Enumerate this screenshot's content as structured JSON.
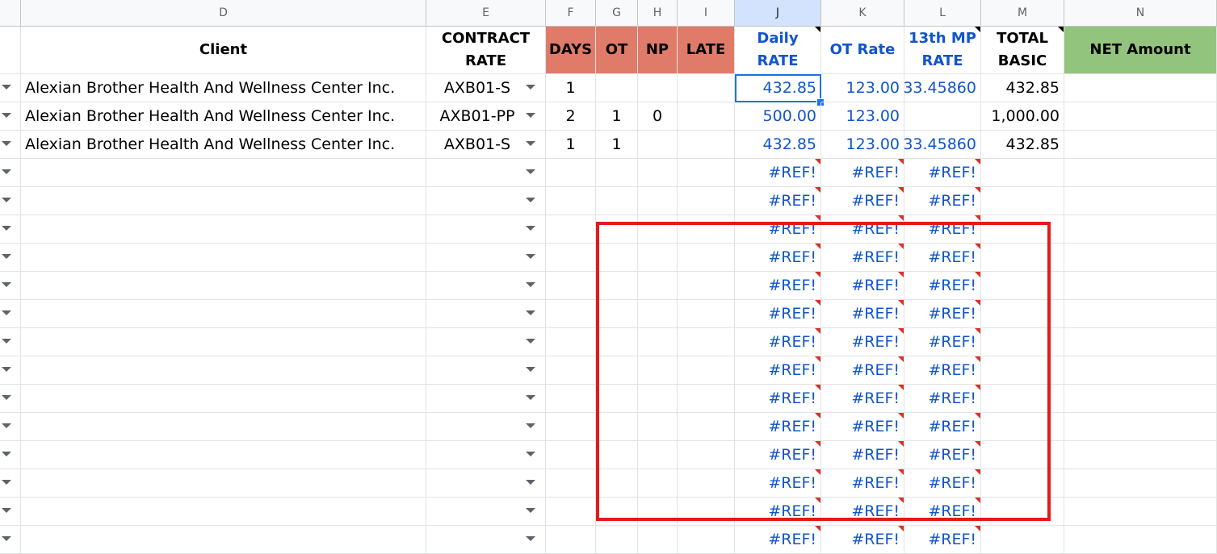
{
  "columns": [
    {
      "letter": "D",
      "selected": false
    },
    {
      "letter": "E",
      "selected": false
    },
    {
      "letter": "F",
      "selected": false
    },
    {
      "letter": "G",
      "selected": false
    },
    {
      "letter": "H",
      "selected": false
    },
    {
      "letter": "I",
      "selected": false
    },
    {
      "letter": "J",
      "selected": true
    },
    {
      "letter": "K",
      "selected": false
    },
    {
      "letter": "L",
      "selected": false
    },
    {
      "letter": "M",
      "selected": false
    },
    {
      "letter": "N",
      "selected": false
    }
  ],
  "headers": [
    {
      "text": "Client",
      "style": "plain",
      "note": false
    },
    {
      "text": "CONTRACT RATE",
      "style": "plain",
      "note": false
    },
    {
      "text": "DAYS",
      "style": "salmon",
      "note": false
    },
    {
      "text": "OT",
      "style": "salmon",
      "note": false
    },
    {
      "text": "NP",
      "style": "salmon",
      "note": false
    },
    {
      "text": "LATE",
      "style": "salmon",
      "note": false
    },
    {
      "text": "Daily RATE",
      "style": "blue",
      "note": true
    },
    {
      "text": "OT Rate",
      "style": "blue",
      "note": false
    },
    {
      "text": "13th MP RATE",
      "style": "blue",
      "note": true
    },
    {
      "text": "TOTAL BASIC",
      "style": "plain",
      "note": true
    },
    {
      "text": "NET Amount",
      "style": "green",
      "note": false
    }
  ],
  "rows": [
    [
      "Alexian Brother Health And Wellness Center Inc.",
      "AXB01-S",
      "1",
      "",
      "",
      "",
      "432.85",
      "123.00",
      "33.45860",
      "432.85",
      ""
    ],
    [
      "Alexian Brother Health And Wellness Center Inc.",
      "AXB01-PP",
      "2",
      "1",
      "0",
      "",
      "500.00",
      "123.00",
      "",
      "1,000.00",
      ""
    ],
    [
      "Alexian Brother Health And Wellness Center Inc.",
      "AXB01-S",
      "1",
      "1",
      "",
      "",
      "432.85",
      "123.00",
      "33.45860",
      "432.85",
      ""
    ],
    [
      "",
      "",
      "",
      "",
      "",
      "",
      "#REF!",
      "#REF!",
      "#REF!",
      "",
      ""
    ],
    [
      "",
      "",
      "",
      "",
      "",
      "",
      "#REF!",
      "#REF!",
      "#REF!",
      "",
      ""
    ],
    [
      "",
      "",
      "",
      "",
      "",
      "",
      "#REF!",
      "#REF!",
      "#REF!",
      "",
      ""
    ],
    [
      "",
      "",
      "",
      "",
      "",
      "",
      "#REF!",
      "#REF!",
      "#REF!",
      "",
      ""
    ],
    [
      "",
      "",
      "",
      "",
      "",
      "",
      "#REF!",
      "#REF!",
      "#REF!",
      "",
      ""
    ],
    [
      "",
      "",
      "",
      "",
      "",
      "",
      "#REF!",
      "#REF!",
      "#REF!",
      "",
      ""
    ],
    [
      "",
      "",
      "",
      "",
      "",
      "",
      "#REF!",
      "#REF!",
      "#REF!",
      "",
      ""
    ],
    [
      "",
      "",
      "",
      "",
      "",
      "",
      "#REF!",
      "#REF!",
      "#REF!",
      "",
      ""
    ],
    [
      "",
      "",
      "",
      "",
      "",
      "",
      "#REF!",
      "#REF!",
      "#REF!",
      "",
      ""
    ],
    [
      "",
      "",
      "",
      "",
      "",
      "",
      "#REF!",
      "#REF!",
      "#REF!",
      "",
      ""
    ],
    [
      "",
      "",
      "",
      "",
      "",
      "",
      "#REF!",
      "#REF!",
      "#REF!",
      "",
      ""
    ],
    [
      "",
      "",
      "",
      "",
      "",
      "",
      "#REF!",
      "#REF!",
      "#REF!",
      "",
      ""
    ],
    [
      "",
      "",
      "",
      "",
      "",
      "",
      "#REF!",
      "#REF!",
      "#REF!",
      "",
      ""
    ],
    [
      "",
      "",
      "",
      "",
      "",
      "",
      "#REF!",
      "#REF!",
      "#REF!",
      "",
      ""
    ]
  ],
  "selected_cell": {
    "row": 0,
    "col": "J"
  },
  "annotation_color": "#e31a1a"
}
